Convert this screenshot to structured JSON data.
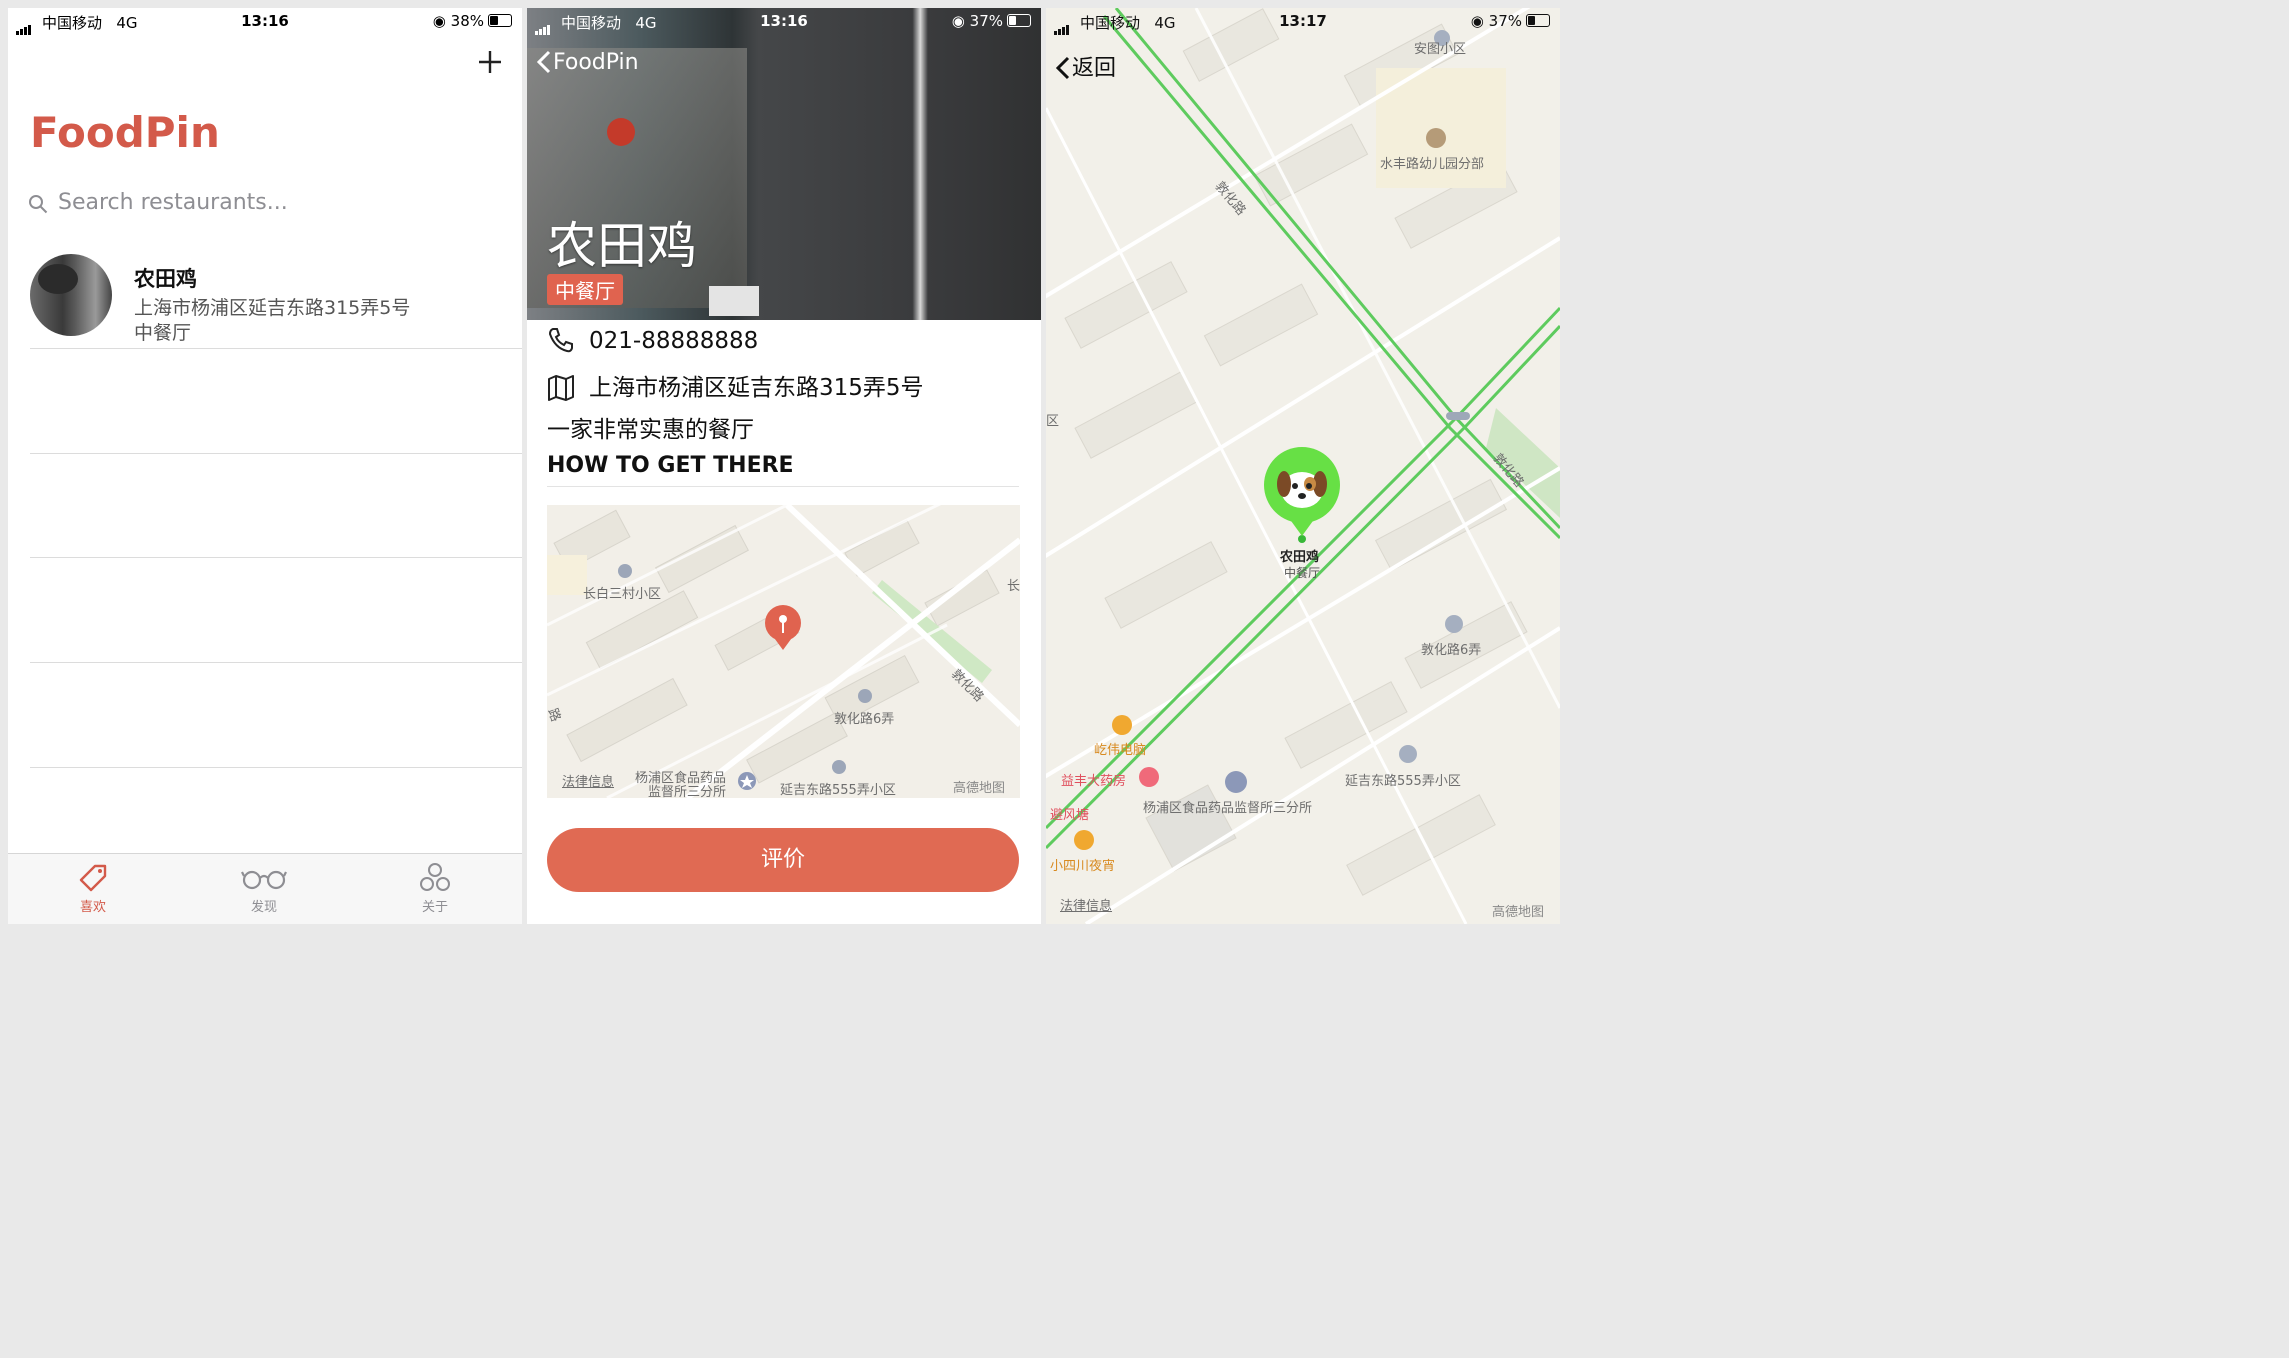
{
  "status_left": {
    "carrier": "中国移动",
    "network": "4G",
    "time": "13:16",
    "battery": "38%"
  },
  "status_mid": {
    "carrier": "中国移动",
    "network": "4G",
    "time": "13:16",
    "battery": "37%"
  },
  "status_right": {
    "carrier": "中国移动",
    "network": "4G",
    "time": "13:17",
    "battery": "37%"
  },
  "list_screen": {
    "add_icon": "plus-icon",
    "title": "FoodPin",
    "search_placeholder": "Search restaurants...",
    "restaurants": [
      {
        "name": "农田鸡",
        "address": "上海市杨浦区延吉东路315弄5号",
        "type": "中餐厅"
      }
    ],
    "tabs": [
      {
        "label": "喜欢",
        "icon": "tag-icon",
        "active": true
      },
      {
        "label": "发现",
        "icon": "glasses-icon",
        "active": false
      },
      {
        "label": "关于",
        "icon": "circles-icon",
        "active": false
      }
    ]
  },
  "detail_screen": {
    "back_label": "FoodPin",
    "name": "农田鸡",
    "type": "中餐厅",
    "phone": "021-88888888",
    "address": "上海市杨浦区延吉东路315弄5号",
    "description": "一家非常实惠的餐厅",
    "section_title": "HOW TO GET THERE",
    "map_labels": {
      "a": "长白三村小区",
      "b": "敦化路6弄",
      "c": "敦化路",
      "d": "杨浦区食品药品",
      "e": "监督所三分所",
      "f": "延吉东路555弄小区",
      "g": "法律信息",
      "h": "高德地图",
      "i": "长",
      "j": "路"
    },
    "rate_button": "评价"
  },
  "map_screen": {
    "back_label": "返回",
    "pin_name": "农田鸡",
    "pin_type": "中餐厅",
    "labels": {
      "anTu": "安图小区",
      "school": "水丰路幼儿园分部",
      "dunhua1": "敦化路",
      "dunhua2": "敦化路",
      "dunhua6": "敦化路6弄",
      "qiwei": "屹伟电脑",
      "yifeng": "益丰大药房",
      "bifeng": "避风塘",
      "xiaosichuan": "小四川夜宵",
      "jiandu": "杨浦区食品药品监督所三分所",
      "yanji555": "延吉东路555弄小区",
      "legal": "法律信息",
      "gaode": "高德地图",
      "edge": "区"
    }
  },
  "colors": {
    "accent": "#d35a4a",
    "button": "#e06a53",
    "route": "#5ecb5e"
  }
}
